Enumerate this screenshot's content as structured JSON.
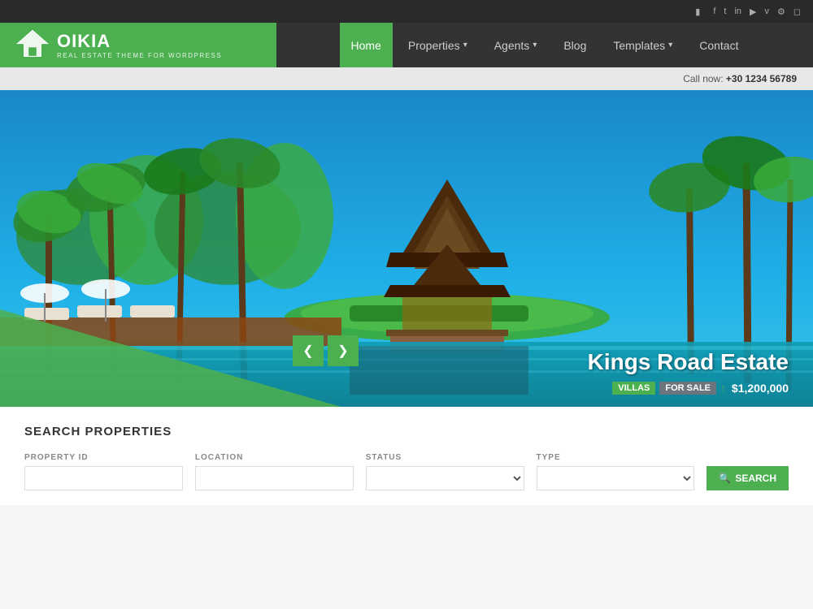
{
  "social_bar": {
    "icons": [
      "facebook",
      "twitter",
      "linkedin",
      "youtube",
      "vine",
      "settings",
      "instagram"
    ]
  },
  "header": {
    "logo": {
      "brand": "OIKIA",
      "tagline": "REAL ESTATE THEME FOR WORDPRESS"
    },
    "nav": [
      {
        "label": "Home",
        "active": true,
        "has_dropdown": false
      },
      {
        "label": "Properties",
        "active": false,
        "has_dropdown": true
      },
      {
        "label": "Agents",
        "active": false,
        "has_dropdown": true
      },
      {
        "label": "Blog",
        "active": false,
        "has_dropdown": false
      },
      {
        "label": "Templates",
        "active": false,
        "has_dropdown": true
      },
      {
        "label": "Contact",
        "active": false,
        "has_dropdown": false
      }
    ]
  },
  "call_bar": {
    "label": "Call now:",
    "phone": "+30 1234 56789"
  },
  "hero": {
    "title": "Kings Road Estate",
    "tags": [
      "VILLAS",
      "FOR SALE"
    ],
    "price_arrow": "↑",
    "price": "$1,200,000",
    "prev_label": "❮",
    "next_label": "❯"
  },
  "search": {
    "section_title": "SEARCH PROPERTIES",
    "fields": [
      {
        "label": "PROPERTY ID",
        "type": "input",
        "placeholder": ""
      },
      {
        "label": "LOCATION",
        "type": "input",
        "placeholder": ""
      },
      {
        "label": "STATUS",
        "type": "select",
        "placeholder": ""
      },
      {
        "label": "TYPE",
        "type": "select",
        "placeholder": ""
      }
    ]
  }
}
